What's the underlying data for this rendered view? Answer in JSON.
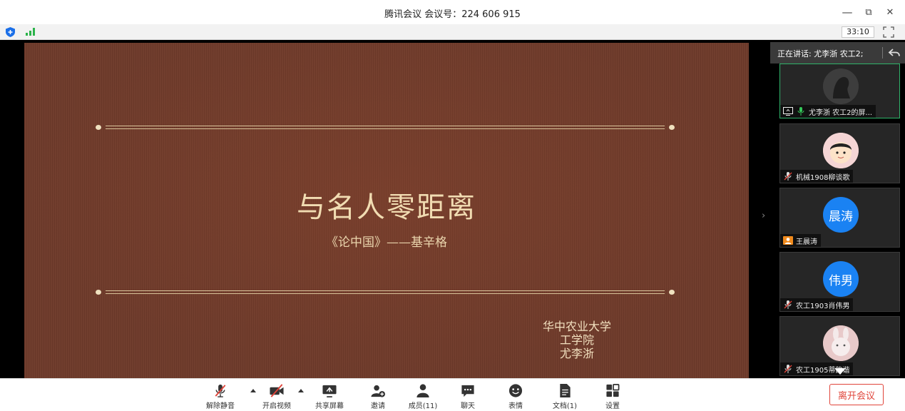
{
  "window": {
    "title": "腾讯会议 会议号：224 606 915",
    "minimize_glyph": "—",
    "restore_glyph": "⧉",
    "close_glyph": "✕"
  },
  "status": {
    "timer": "33:10",
    "shield_color": "#1a6fe8",
    "signal_color": "#2bb34a"
  },
  "slide": {
    "title": "与名人零距离",
    "subtitle": "《论中国》——基辛格",
    "author_lines": [
      "华中农业大学",
      "工学院",
      "尤李浙"
    ],
    "background_color": "#6e3a2a",
    "text_color": "#f1dcb2"
  },
  "panel": {
    "expand_glyph": "›",
    "speaking_text": "正在讲话: 尤李浙 农工2;",
    "participants": [
      {
        "name": "尤李浙 农工2的屏...",
        "avatar": "dark-silhouette-avatar",
        "status_icons": [
          "screen-share-icon",
          "mic-on-icon"
        ],
        "active": true
      },
      {
        "name": "机械1908柳谈歌",
        "avatar": "cartoon-boy-avatar",
        "status_icons": [
          "mic-muted-icon"
        ],
        "active": false
      },
      {
        "name": "王晨涛",
        "avatar_text": "晨涛",
        "avatar": "text-avatar",
        "status_icons": [
          "user-orange-icon"
        ],
        "active": false
      },
      {
        "name": "农工1903肖伟男",
        "avatar_text": "伟男",
        "avatar": "text-avatar",
        "status_icons": [
          "mic-muted-icon"
        ],
        "active": false
      },
      {
        "name": "农工1905蒂韵谐",
        "avatar": "cartoon-rabbit-avatar",
        "status_icons": [
          "mic-muted-icon"
        ],
        "active": false
      }
    ],
    "avatar_blue": "#1a82f3"
  },
  "toolbar": {
    "unmute": "解除静音",
    "start_video": "开启视频",
    "share_screen": "共享屏幕",
    "invite": "邀请",
    "members": "成员(11)",
    "chat": "聊天",
    "emoji": "表情",
    "docs": "文档(1)",
    "settings": "设置",
    "leave": "离开会议",
    "leave_color": "#e0443a"
  }
}
